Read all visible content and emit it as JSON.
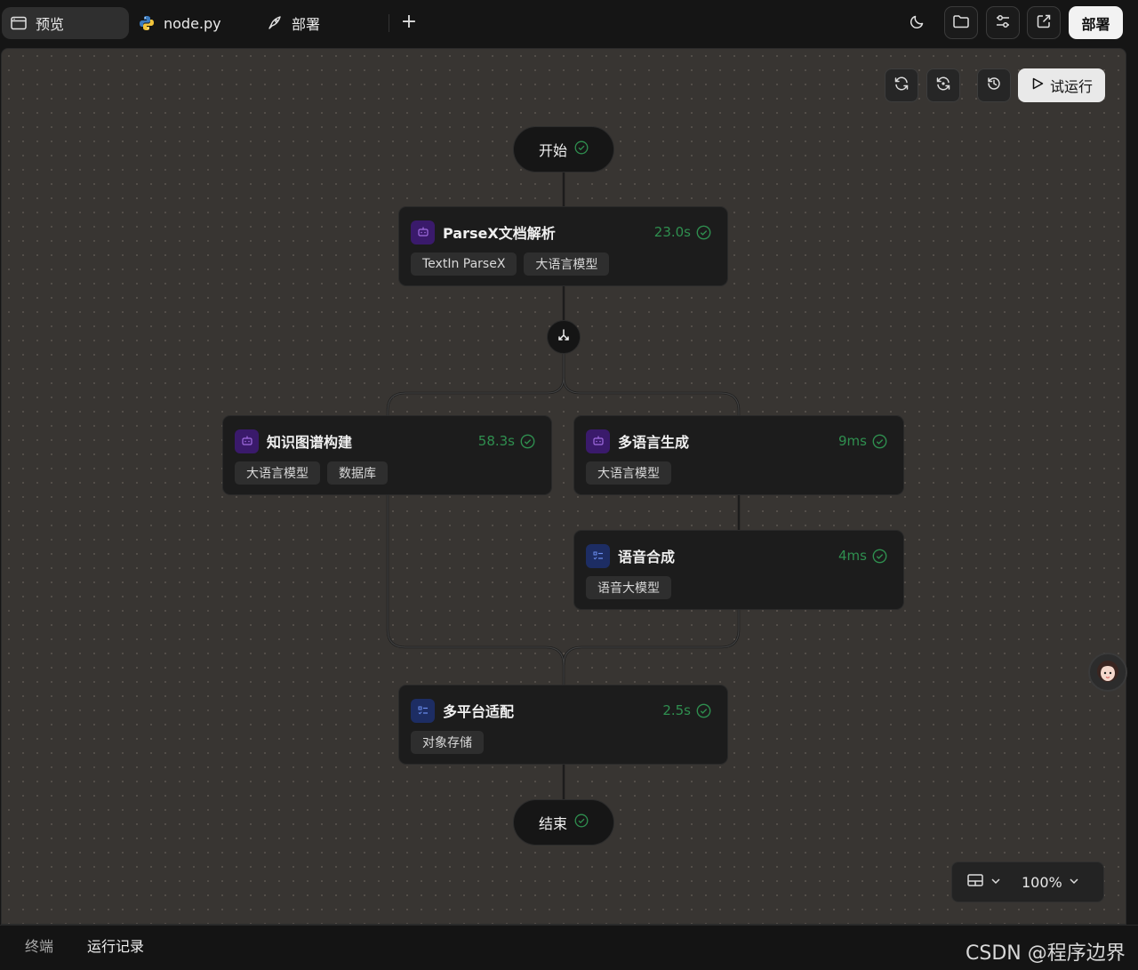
{
  "topbar": {
    "tabs": [
      {
        "label": "预览",
        "icon": "browser-window-icon"
      },
      {
        "label": "node.py",
        "icon": "python-icon"
      },
      {
        "label": "部署",
        "icon": "rocket-icon"
      }
    ],
    "add_tab": "+",
    "deploy_label": "部署"
  },
  "canvas_toolbar": {
    "run_label": "试运行"
  },
  "workflow": {
    "start": {
      "label": "开始"
    },
    "end": {
      "label": "结束"
    },
    "nodes": [
      {
        "title": "ParseX文档解析",
        "time": "23.0s",
        "icon_color": "purple",
        "tags": [
          "TextIn ParseX",
          "大语言模型"
        ]
      },
      {
        "title": "知识图谱构建",
        "time": "58.3s",
        "icon_color": "purple",
        "tags": [
          "大语言模型",
          "数据库"
        ]
      },
      {
        "title": "多语言生成",
        "time": "9ms",
        "icon_color": "purple",
        "tags": [
          "大语言模型"
        ]
      },
      {
        "title": "语音合成",
        "time": "4ms",
        "icon_color": "blue",
        "tags": [
          "语音大模型"
        ]
      },
      {
        "title": "多平台适配",
        "time": "2.5s",
        "icon_color": "blue",
        "tags": [
          "对象存储"
        ]
      }
    ]
  },
  "zoom": {
    "level": "100%"
  },
  "bottombar": {
    "tabs": [
      "终端",
      "运行记录"
    ]
  },
  "watermark": "CSDN @程序边界",
  "colors": {
    "success": "#2f8f4f",
    "purple_icon": "#3a1a6b",
    "blue_icon": "#1d2d63"
  }
}
